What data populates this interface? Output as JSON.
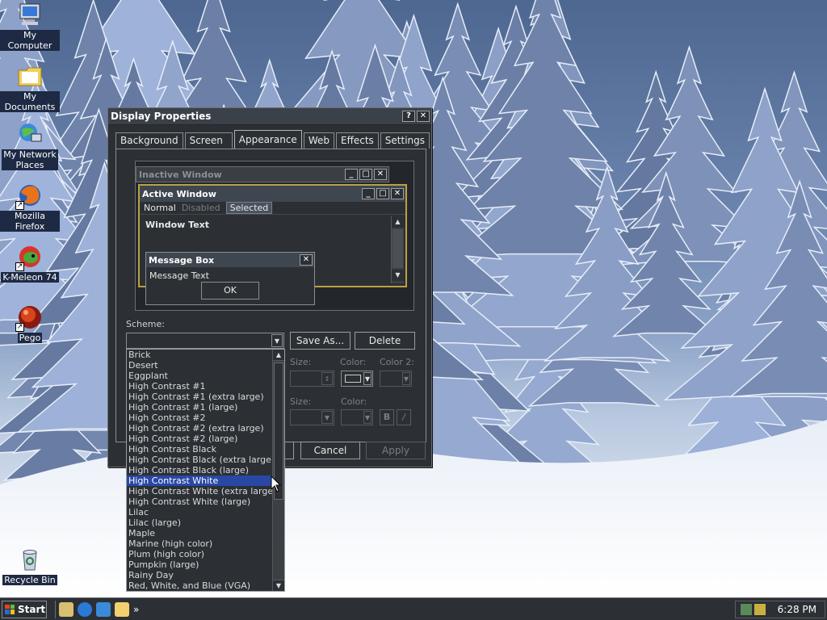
{
  "desktop": {
    "icons": [
      {
        "label": "My Computer",
        "icon": "computer-icon"
      },
      {
        "label": "My Documents",
        "icon": "folder-icon"
      },
      {
        "label": "My Network Places",
        "icon": "network-icon"
      },
      {
        "label": "Mozilla Firefox",
        "icon": "firefox-icon"
      },
      {
        "label": "K-Meleon 74",
        "icon": "kmeleon-icon"
      },
      {
        "label": "Pego",
        "icon": "pego-icon"
      },
      {
        "label": "Recycle Bin",
        "icon": "recycle-bin-icon"
      }
    ]
  },
  "window": {
    "title": "Display Properties",
    "help_glyph": "?",
    "close_glyph": "✕",
    "tabs": [
      "Background",
      "Screen Saver",
      "Appearance",
      "Web",
      "Effects",
      "Settings"
    ],
    "active_tab": "Appearance",
    "preview": {
      "inactive_title": "Inactive Window",
      "active_title": "Active Window",
      "menu_normal": "Normal",
      "menu_disabled": "Disabled",
      "menu_selected": "Selected",
      "window_text": "Window Text",
      "msgbox_title": "Message Box",
      "msgbox_text": "Message Text",
      "ok_label": "OK"
    },
    "scheme_label": "Scheme:",
    "save_as_label": "Save As...",
    "delete_label": "Delete",
    "item_size_label": "Size:",
    "item_color_label": "Color:",
    "item_color2_label": "Color 2:",
    "font_size_label": "Size:",
    "font_color_label": "Color:",
    "bold_label": "B",
    "italic_label": "/",
    "cancel_label": "Cancel",
    "apply_label": "Apply"
  },
  "scheme_dropdown": {
    "items": [
      "Brick",
      "Desert",
      "Eggplant",
      "High Contrast #1",
      "High Contrast #1 (extra large)",
      "High Contrast #1 (large)",
      "High Contrast #2",
      "High Contrast #2 (extra large)",
      "High Contrast #2 (large)",
      "High Contrast Black",
      "High Contrast Black (extra large)",
      "High Contrast Black (large)",
      "High Contrast White",
      "High Contrast White (extra large)",
      "High Contrast White (large)",
      "Lilac",
      "Lilac (large)",
      "Maple",
      "Marine (high color)",
      "Plum (high color)",
      "Pumpkin (large)",
      "Rainy Day",
      "Red, White, and Blue (VGA)"
    ],
    "selected": "High Contrast White"
  },
  "taskbar": {
    "start_label": "Start",
    "chevron": "»",
    "clock": "6:28 PM"
  },
  "colors": {
    "window_bg": "#2c3034",
    "selection": "#2948a6",
    "active_border": "#b9a240"
  }
}
